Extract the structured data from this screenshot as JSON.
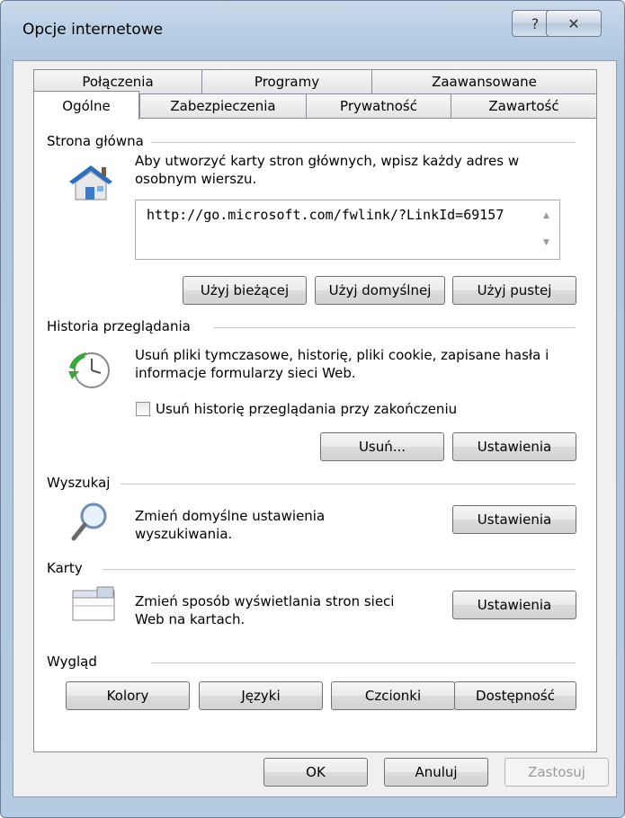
{
  "window": {
    "title": "Opcje internetowe",
    "help_glyph": "?",
    "close_glyph": "✕"
  },
  "tabs": {
    "back_row": [
      "Połączenia",
      "Programy",
      "Zaawansowane"
    ],
    "front_row": [
      "Ogólne",
      "Zabezpieczenia",
      "Prywatność",
      "Zawartość"
    ],
    "active": "Ogólne"
  },
  "home": {
    "title": "Strona główna",
    "description": "Aby utworzyć karty stron głównych, wpisz każdy adres w osobnym wierszu.",
    "url": "http://go.microsoft.com/fwlink/?LinkId=69157",
    "buttons": [
      "Użyj bieżącej",
      "Użyj domyślnej",
      "Użyj pustej"
    ]
  },
  "history": {
    "title": "Historia przeglądania",
    "description": "Usuń pliki tymczasowe, historię, pliki cookie, zapisane hasła i informacje formularzy sieci Web.",
    "checkbox_label": "Usuń historię przeglądania przy zakończeniu",
    "checkbox_checked": false,
    "delete_button": "Usuń...",
    "settings_button": "Ustawienia"
  },
  "search": {
    "title": "Wyszukaj",
    "description": "Zmień domyślne ustawienia wyszukiwania.",
    "settings_button": "Ustawienia"
  },
  "cards": {
    "title": "Karty",
    "description": "Zmień sposób wyświetlania stron sieci Web na kartach.",
    "settings_button": "Ustawienia"
  },
  "appearance": {
    "title": "Wygląd",
    "buttons": [
      "Kolory",
      "Języki",
      "Czcionki",
      "Dostępność"
    ]
  },
  "footer": {
    "ok": "OK",
    "cancel": "Anuluj",
    "apply": "Zastosuj"
  }
}
